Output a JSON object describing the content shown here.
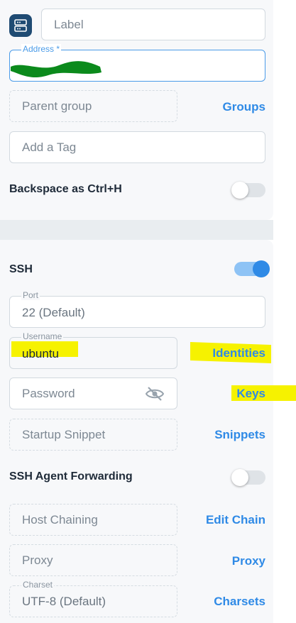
{
  "colors": {
    "accent": "#2f8ae6",
    "panel_bg": "#f7f8fa",
    "app_icon_bg": "#1f4b73",
    "annotation_highlight": "#f6f200",
    "annotation_redaction": "#0b8a1c"
  },
  "host": {
    "icon": "server-icon",
    "label_placeholder": "Label",
    "address_label": "Address *",
    "address_value": "",
    "parent_group_placeholder": "Parent group",
    "groups_link": "Groups",
    "tag_placeholder": "Add a Tag",
    "backspace_label": "Backspace as Ctrl+H",
    "backspace_enabled": false
  },
  "ssh": {
    "title": "SSH",
    "enabled": true,
    "port_label": "Port",
    "port_value": "22 (Default)",
    "username_label": "Username",
    "username_value": "ubuntu",
    "identities_link": "Identities",
    "password_placeholder": "Password",
    "password_icon": "eye-off-icon",
    "keys_link": "Keys",
    "startup_snippet_placeholder": "Startup Snippet",
    "snippets_link": "Snippets",
    "agent_forwarding_label": "SSH Agent Forwarding",
    "agent_forwarding_enabled": false,
    "host_chaining_placeholder": "Host Chaining",
    "edit_chain_link": "Edit Chain",
    "proxy_placeholder": "Proxy",
    "proxy_link": "Proxy",
    "charset_label": "Charset",
    "charset_value": "UTF-8 (Default)",
    "charsets_link": "Charsets"
  }
}
